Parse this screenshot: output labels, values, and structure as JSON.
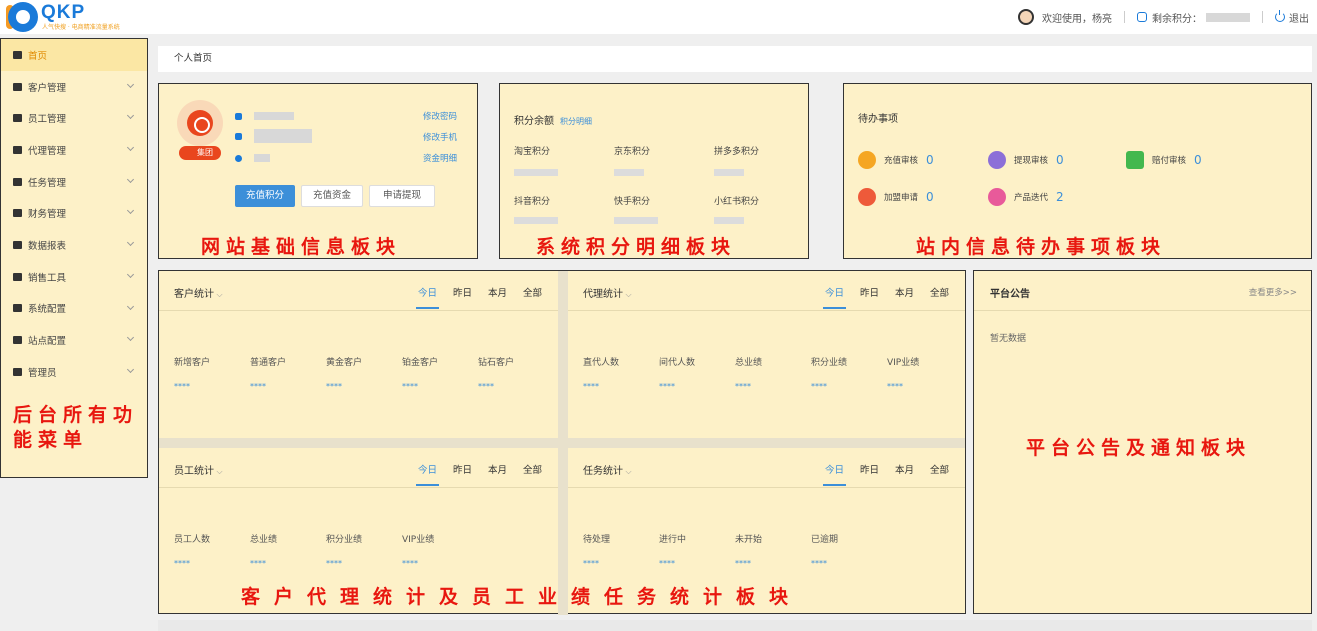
{
  "header": {
    "brand": "QKP",
    "brand_tagline": "人气快搜 · 电商精准流量系统",
    "welcome": "欢迎使用，杨亮",
    "points_label": "剩余积分：",
    "logout": "退出"
  },
  "sidebar": {
    "items": [
      {
        "label": "首页",
        "icon": "home-icon"
      },
      {
        "label": "客户管理",
        "icon": "customer-icon"
      },
      {
        "label": "员工管理",
        "icon": "employee-icon"
      },
      {
        "label": "代理管理",
        "icon": "agent-icon"
      },
      {
        "label": "任务管理",
        "icon": "task-icon"
      },
      {
        "label": "财务管理",
        "icon": "finance-icon"
      },
      {
        "label": "数据报表",
        "icon": "report-icon"
      },
      {
        "label": "销售工具",
        "icon": "tools-icon"
      },
      {
        "label": "系统配置",
        "icon": "settings-icon"
      },
      {
        "label": "站点配置",
        "icon": "share-icon"
      },
      {
        "label": "管理员",
        "icon": "admin-icon"
      }
    ],
    "caption": "后台所有功能菜单"
  },
  "breadcrumb": "个人首页",
  "basic_info": {
    "badge": "集团",
    "links": [
      "修改密码",
      "修改手机",
      "资金明细"
    ],
    "buttons": [
      "充值积分",
      "充值资金",
      "申请提现"
    ],
    "caption": "网站基础信息板块"
  },
  "points": {
    "title": "积分余额",
    "detail_link": "积分明细",
    "items": [
      "淘宝积分",
      "京东积分",
      "拼多多积分",
      "抖音积分",
      "快手积分",
      "小红书积分"
    ],
    "caption": "系统积分明细板块"
  },
  "todo": {
    "title": "待办事项",
    "items": [
      {
        "label": "充值审核",
        "count": "0",
        "color": "#f5a623"
      },
      {
        "label": "提现审核",
        "count": "0",
        "color": "#8c6fd8"
      },
      {
        "label": "赔付审核",
        "count": "0",
        "color": "#43b84e"
      },
      {
        "label": "加盟申请",
        "count": "0",
        "color": "#ee5a3a"
      },
      {
        "label": "产品迭代",
        "count": "2",
        "color": "#e85a9a"
      }
    ],
    "caption": "站内信息待办事项板块"
  },
  "stats": {
    "tabs": [
      "今日",
      "昨日",
      "本月",
      "全部"
    ],
    "placeholder": "****",
    "blocks": [
      {
        "title": "客户统计",
        "cols": [
          "新增客户",
          "普通客户",
          "黄金客户",
          "铂金客户",
          "钻石客户"
        ]
      },
      {
        "title": "代理统计",
        "cols": [
          "直代人数",
          "间代人数",
          "总业绩",
          "积分业绩",
          "VIP业绩"
        ]
      },
      {
        "title": "员工统计",
        "cols": [
          "员工人数",
          "总业绩",
          "积分业绩",
          "VIP业绩"
        ]
      },
      {
        "title": "任务统计",
        "cols": [
          "待处理",
          "进行中",
          "未开始",
          "已逾期"
        ]
      }
    ],
    "caption": "客户代理统计及员工业绩任务统计板块"
  },
  "notice": {
    "title": "平台公告",
    "more": "查看更多>>",
    "empty": "暂无数据",
    "caption": "平台公告及通知板块"
  },
  "colors": {
    "accent": "#3c8fd9",
    "highlight": "#fdf1c8",
    "caption": "#e8170f"
  }
}
